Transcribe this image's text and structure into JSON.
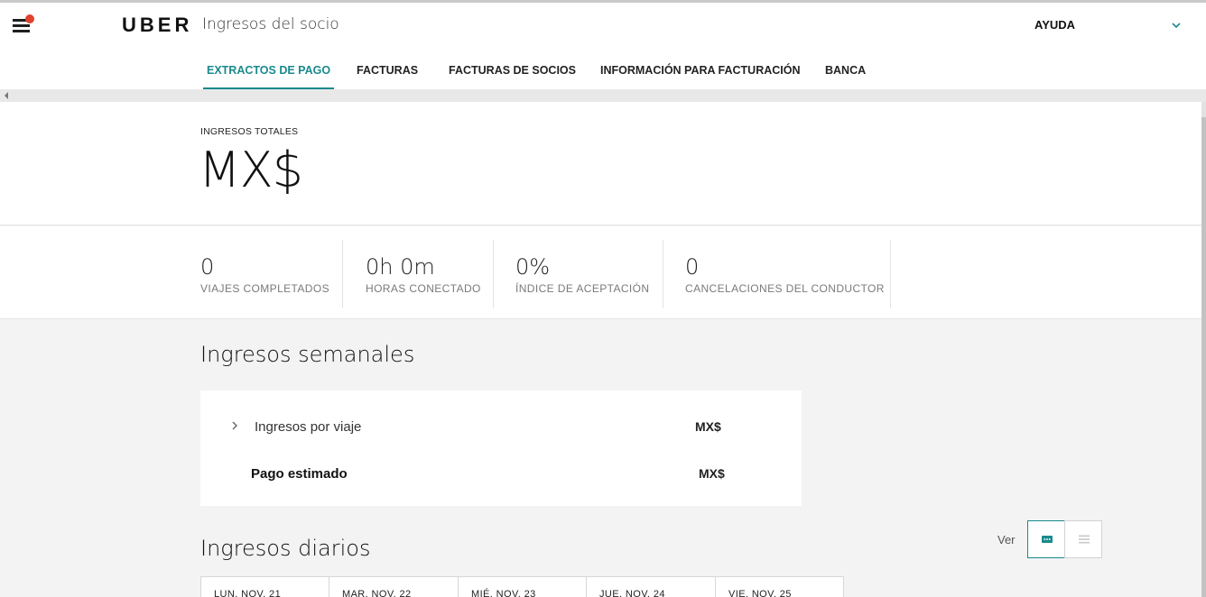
{
  "header": {
    "logo": "UBER",
    "section_title": "Ingresos del socio",
    "help_label": "AYUDA"
  },
  "tabs": [
    {
      "label": "EXTRACTOS DE PAGO",
      "active": true
    },
    {
      "label": "FACTURAS",
      "active": false
    },
    {
      "label": "FACTURAS DE SOCIOS",
      "active": false
    },
    {
      "label": "INFORMACIÓN PARA FACTURACIÓN",
      "active": false
    },
    {
      "label": "BANCA",
      "active": false
    }
  ],
  "summary": {
    "total_label": "INGRESOS TOTALES",
    "total_value": "MX$"
  },
  "stats": [
    {
      "value": "0",
      "label": "VIAJES COMPLETADOS"
    },
    {
      "value": "0h 0m",
      "label": "HORAS CONECTADO"
    },
    {
      "value": "0%",
      "label": "ÍNDICE DE ACEPTACIÓN"
    },
    {
      "value": "0",
      "label": "CANCELACIONES DEL CONDUCTOR"
    }
  ],
  "weekly": {
    "title": "Ingresos semanales",
    "rows": [
      {
        "label": "Ingresos por viaje",
        "value": "MX$"
      },
      {
        "label": "Pago estimado",
        "value": "MX$"
      }
    ]
  },
  "daily": {
    "title": "Ingresos diarios",
    "view_label": "Ver",
    "days": [
      "LUN. NOV. 21",
      "MAR. NOV. 22",
      "MIÉ. NOV. 23",
      "JUE. NOV. 24",
      "VIE. NOV. 25"
    ]
  },
  "colors": {
    "accent": "#1a8a8c",
    "notification": "#e0412c",
    "background": "#f3f3f4"
  },
  "icons": {
    "menu": "hamburger-icon",
    "help_dropdown": "chevron-down-icon",
    "expand_row": "chevron-right-icon",
    "card_view": "card-view-icon",
    "list_view": "list-view-icon"
  }
}
